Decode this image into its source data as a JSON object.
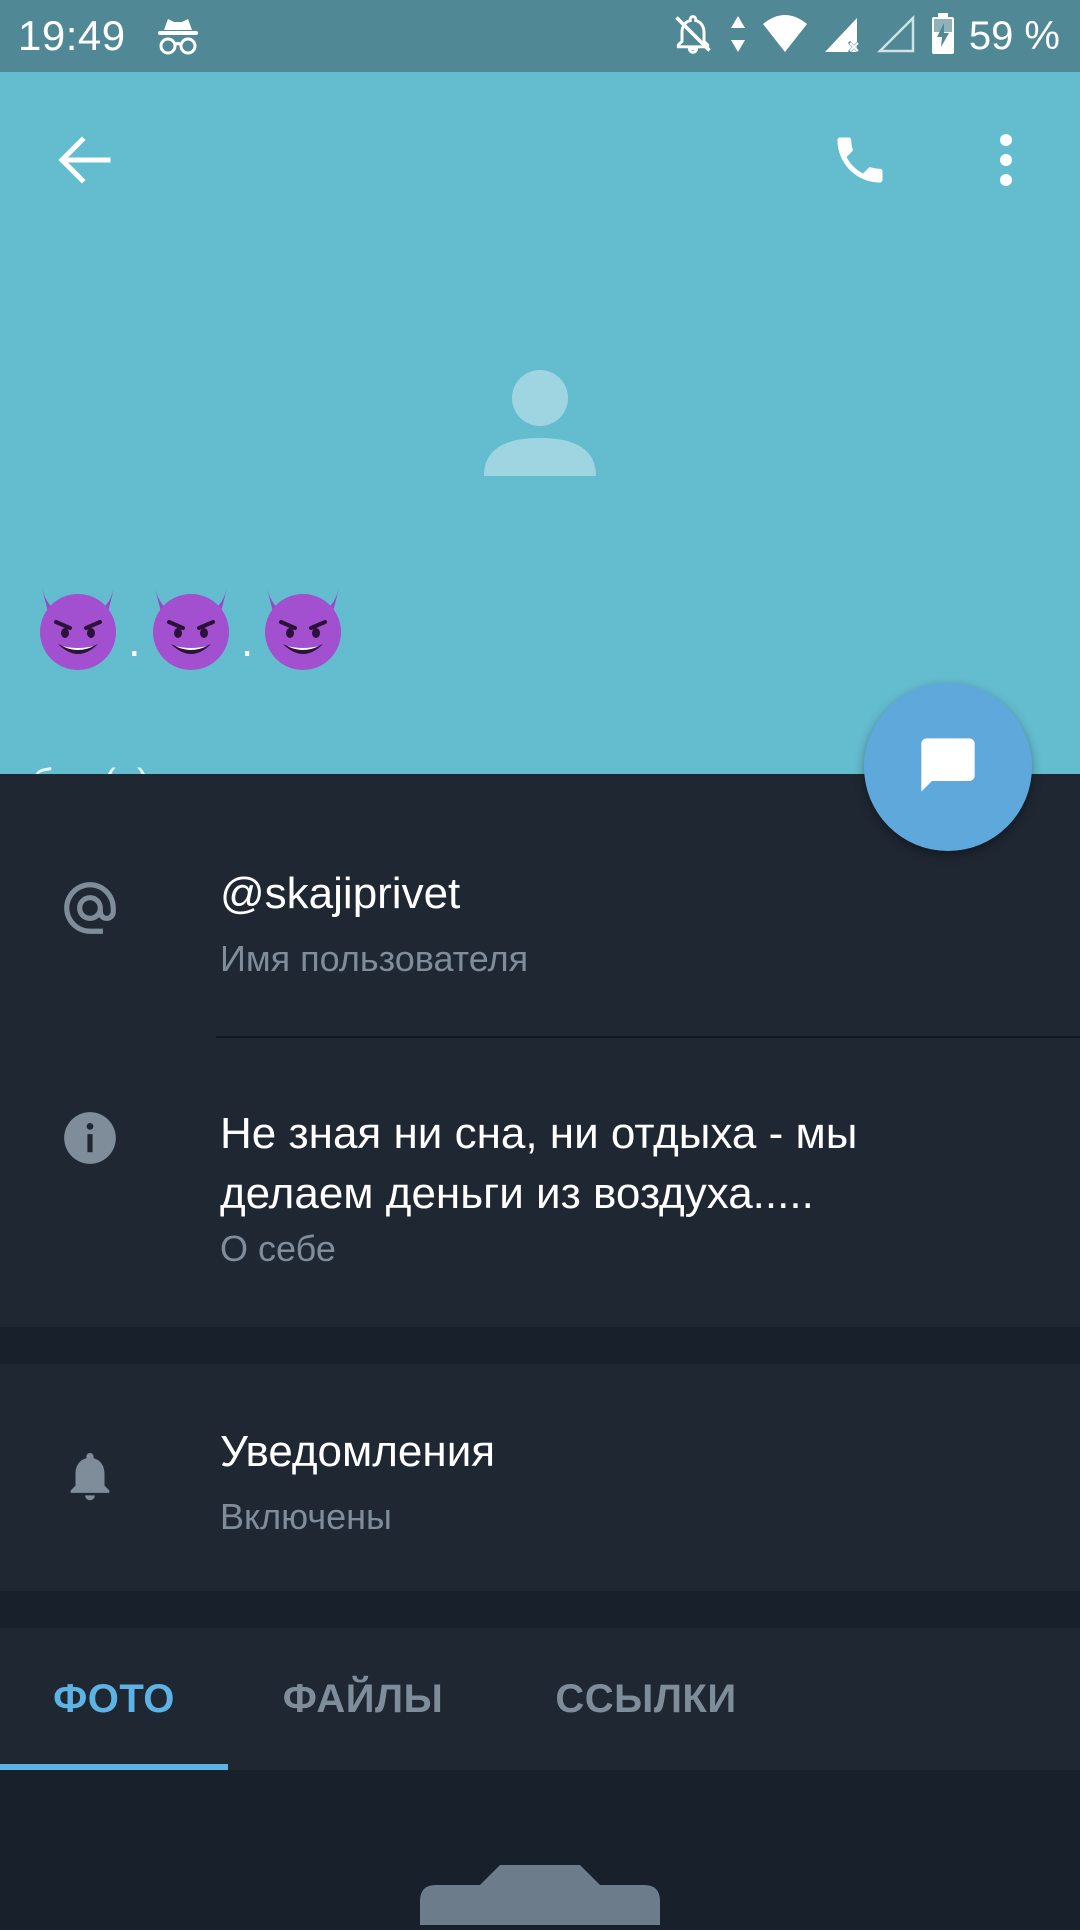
{
  "status_bar": {
    "time": "19:49",
    "battery_percent": "59 %",
    "icons": [
      "incognito-icon",
      "notifications-off-icon",
      "data-arrows-icon",
      "wifi-icon",
      "cell-signal-icon",
      "cell-signal-empty-icon",
      "battery-charging-icon"
    ]
  },
  "header": {
    "background": "#64bccf",
    "name_emoji": "smiling-face-with-horns",
    "name_separator": ".",
    "last_seen": "был(а) давно"
  },
  "info": {
    "username": "@skajiprivet",
    "username_label": "Имя пользователя",
    "bio": "Не зная ни сна, ни отдыха - мы делаем деньги из воздуха.....",
    "bio_label": "О себе"
  },
  "notifications": {
    "title": "Уведомления",
    "status": "Включены"
  },
  "tabs": [
    {
      "label": "ФОТО",
      "active": true
    },
    {
      "label": "ФАЙЛЫ",
      "active": false
    },
    {
      "label": "ССЫЛКИ",
      "active": false
    }
  ],
  "colors": {
    "accent": "#5eb3e5",
    "fab": "#5fa8dc",
    "surface": "#1f2733",
    "background": "#17202b",
    "status_bar": "#508895"
  }
}
